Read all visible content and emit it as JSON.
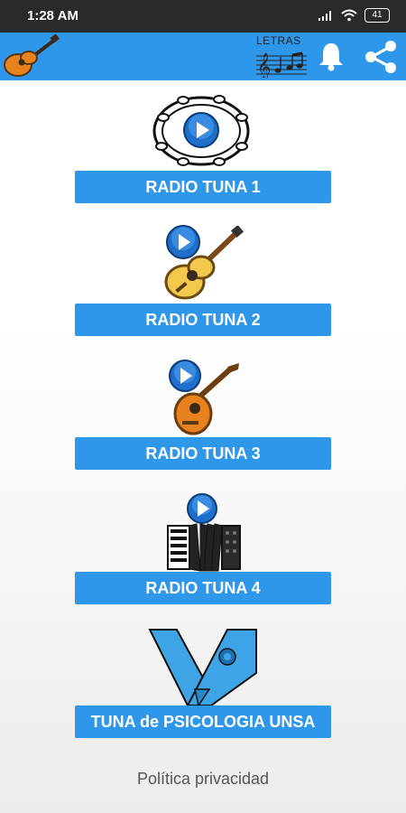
{
  "status_bar": {
    "time": "1:28 AM",
    "battery": "41",
    "icons": [
      "signal-icon",
      "wifi-icon",
      "battery-icon"
    ]
  },
  "app_bar": {
    "color": "#2f97ea",
    "logo": "guitar-icon",
    "letras_label": "LETRAS",
    "actions": [
      "music-score-icon",
      "bell-icon",
      "share-icon"
    ]
  },
  "stations": [
    {
      "label": "RADIO TUNA 1",
      "icon": "tambourine-icon"
    },
    {
      "label": "RADIO TUNA 2",
      "icon": "guitar-icon"
    },
    {
      "label": "RADIO TUNA 3",
      "icon": "lute-icon"
    },
    {
      "label": "RADIO TUNA 4",
      "icon": "accordion-icon"
    }
  ],
  "tuna_banner": {
    "label": "TUNA de PSICOLOGIA UNSA",
    "icon": "sash-icon"
  },
  "footer": {
    "privacy_link": "Política privacidad"
  }
}
